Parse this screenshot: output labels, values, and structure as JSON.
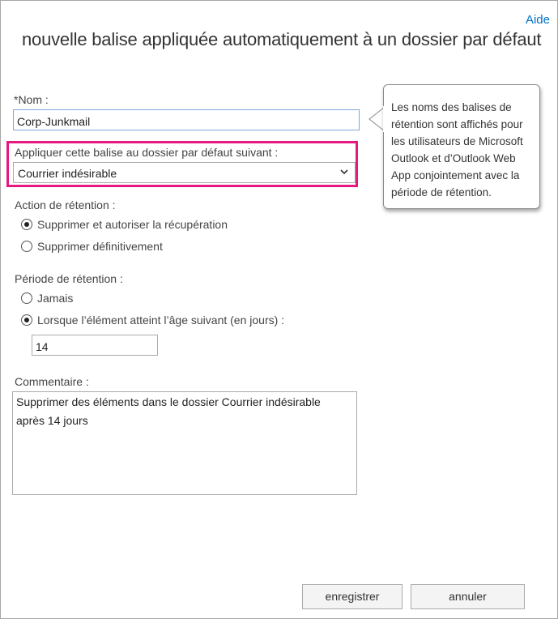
{
  "header": {
    "help_link": "Aide",
    "title": "nouvelle balise appliquée automatiquement à un dossier par défaut"
  },
  "name_field": {
    "label": "*Nom :",
    "value": "Corp-Junkmail"
  },
  "default_folder": {
    "label": "Appliquer cette balise au dossier par défaut suivant :",
    "selected": "Courrier indésirable",
    "icon": "chevron-down-icon"
  },
  "retention_action": {
    "label": "Action de rétention :",
    "options": [
      {
        "label": "Supprimer et autoriser la récupération",
        "checked": true
      },
      {
        "label": "Supprimer définitivement",
        "checked": false
      }
    ]
  },
  "retention_period": {
    "label": "Période de rétention :",
    "options": [
      {
        "label": "Jamais",
        "checked": false
      },
      {
        "label": "Lorsque l’élément atteint l’âge suivant (en jours) :",
        "checked": true
      }
    ],
    "days_value": "14"
  },
  "comment": {
    "label": "Commentaire :",
    "value": "Supprimer des éléments dans le dossier Courrier indésirable\naprès 14 jours"
  },
  "callout": {
    "text": "Les noms des balises de rétention sont affichés pour les utilisateurs de Microsoft Outlook et d’Outlook Web App conjointement avec la période de rétention."
  },
  "footer": {
    "save_label": "enregistrer",
    "cancel_label": "annuler"
  },
  "colors": {
    "accent_link": "#0072c6",
    "highlight_border": "#e5197f"
  }
}
